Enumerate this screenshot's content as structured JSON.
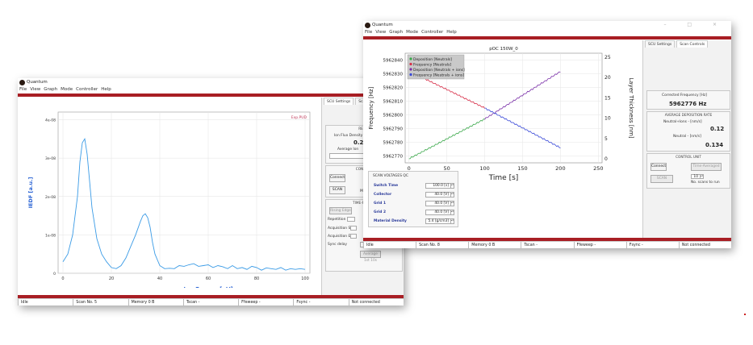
{
  "app": {
    "title": "Quantum"
  },
  "menu": [
    "File",
    "View",
    "Graph",
    "Mode",
    "Controller",
    "Help"
  ],
  "colors": {
    "accent": "#a81e24",
    "iedf_line": "#3a9be6",
    "dep_neutrals": "#3aa84a",
    "freq_neutrals": "#d8304a",
    "dep_neutrals_ions": "#7a2fa8",
    "freq_neutrals_ions": "#3a4ad8"
  },
  "back_window": {
    "tabs": [
      "SCU Settings",
      "Sca"
    ],
    "plot": {
      "corner_label": "Exp.PUD",
      "ylabel": "IEDF [a.u.]",
      "xlabel": "Ion Energy [eV]"
    },
    "panel": {
      "results_title": "RESUL",
      "ion_flux_label": "Ion Flux Density",
      "ion_flux_value": "0.2",
      "avg_label": "Average Ion",
      "control_title": "CONTROL",
      "connect": "Connect",
      "scan": "SCAN",
      "scan_side": "M",
      "time_title": "TIME-RESOLV",
      "rising_edge": "Rising Edge",
      "repetition": "Repetition",
      "acq_start": "Acquisition Start",
      "acq_end": "Acquisition End",
      "sync_delay": "Sync delay",
      "sync_value": "0 ns",
      "average_btn": "Average 1st 10s"
    },
    "status": [
      "Idle",
      "Scan No. 5",
      "Memory 0 B",
      "Tscan -",
      "Ffeweep -",
      "Fsync -",
      "Not connected"
    ]
  },
  "front_window": {
    "tabs": [
      "SCU Settings",
      "Scan Controls"
    ],
    "plot": {
      "title": "pOC 150W_0",
      "ylabel": "Frequency [Hz]",
      "y2label": "Layer Thickness [nm]",
      "xlabel": "Time [s]"
    },
    "scan_voltages": {
      "title": "SCAN VOLTAGES QC",
      "rows": [
        {
          "label": "Switch Time",
          "value": "100.0 [s]"
        },
        {
          "label": "Collector",
          "value": "40.0 [V]"
        },
        {
          "label": "Grid 1",
          "value": "40.0 [V]"
        },
        {
          "label": "Grid 2",
          "value": "40.0 [V]"
        },
        {
          "label": "Material Density",
          "value": "5.4 [g/cm3]"
        }
      ]
    },
    "panel": {
      "corrected_label": "Corrected Frequency [Hz]",
      "corrected_value": "5962776 Hz",
      "rate_title": "AVERAGE DEPOSITION RATE",
      "neutral_ions_label": "Neutral+Ions - [nm/s]",
      "neutral_ions_value": "0.12",
      "neutral_label": "Neutral - [nm/s]",
      "neutral_value": "0.134",
      "control_title": "CONTROL UNIT",
      "connect": "Connect",
      "time_averaged": "Time-Averaged",
      "scan": "SCAN",
      "scans_value": "10",
      "scans_label": "No. scans to run"
    },
    "status": [
      "Idle",
      "Scan No. 8",
      "Memory 0 B",
      "Tscan -",
      "Ffeweep -",
      "Fsync -",
      "Not connected"
    ]
  },
  "chart_data": [
    {
      "type": "line",
      "title": "",
      "xlabel": "Ion Energy [eV]",
      "ylabel": "IEDF [a.u.]",
      "xlim": [
        -2,
        102
      ],
      "ylim": [
        0,
        4.2e-08
      ],
      "x_ticks": [
        0,
        20,
        40,
        60,
        80,
        100
      ],
      "y_ticks": [
        0,
        1e-08,
        2e-08,
        3e-08,
        4e-08
      ],
      "y_tick_labels": [
        "0",
        "1e-08",
        "2e-08",
        "3e-08",
        "4e-08"
      ],
      "grid": true,
      "series": [
        {
          "x": [
            0,
            2,
            4,
            6,
            7,
            8,
            9,
            10,
            11,
            12,
            14,
            16,
            18,
            20,
            22,
            24,
            26,
            28,
            30,
            32,
            33,
            34,
            35,
            36,
            37,
            38,
            40,
            42,
            44,
            46,
            48,
            50,
            52,
            54,
            56,
            58,
            60,
            62,
            64,
            66,
            68,
            70,
            72,
            74,
            76,
            78,
            80,
            82,
            84,
            86,
            88,
            90,
            92,
            94,
            96,
            98,
            100
          ],
          "y": [
            3e-09,
            5e-09,
            1e-08,
            2e-08,
            2.9e-08,
            3.4e-08,
            3.5e-08,
            3.1e-08,
            2.4e-08,
            1.7e-08,
            9e-09,
            5e-09,
            3e-09,
            1.5e-09,
            1.2e-09,
            2e-09,
            4e-09,
            7e-09,
            1e-08,
            1.35e-08,
            1.5e-08,
            1.55e-08,
            1.45e-08,
            1.2e-08,
            8e-09,
            5e-09,
            2e-09,
            1.2e-09,
            1.3e-09,
            1.2e-09,
            2e-09,
            1.8e-09,
            2.2e-09,
            2.5e-09,
            1.8e-09,
            2e-09,
            2.2e-09,
            1.5e-09,
            2e-09,
            1.7e-09,
            1.2e-09,
            2e-09,
            1.2e-09,
            1.5e-09,
            1e-09,
            1.8e-09,
            1.5e-09,
            8e-10,
            1.4e-09,
            1.2e-09,
            1e-09,
            1.5e-09,
            8e-10,
            1.2e-09,
            1e-09,
            1.2e-09,
            1e-09
          ]
        }
      ]
    },
    {
      "type": "line",
      "title": "pOC 150W_0",
      "xlabel": "Time [s]",
      "ylabel": "Frequency [Hz]",
      "y2label": "Layer Thickness [nm]",
      "xlim": [
        -5,
        255
      ],
      "ylim": [
        5962765,
        5962845
      ],
      "y2lim": [
        -1,
        26
      ],
      "x_ticks": [
        0,
        50,
        100,
        150,
        200,
        250
      ],
      "y_ticks": [
        5962770,
        5962780,
        5962790,
        5962800,
        5962810,
        5962820,
        5962830,
        5962840
      ],
      "y2_ticks": [
        0,
        5,
        10,
        15,
        20,
        25
      ],
      "grid": true,
      "legend": "top-left",
      "series": [
        {
          "name": "Deposition [Neutrals]",
          "axis": "y2",
          "x": [
            0,
            100
          ],
          "y": [
            0,
            9.8
          ]
        },
        {
          "name": "Frequency [Neutrals]",
          "axis": "y",
          "x": [
            0,
            100
          ],
          "y": [
            5962832,
            5962805
          ]
        },
        {
          "name": "Deposition [Neutrals + ions]",
          "axis": "y2",
          "x": [
            100,
            200
          ],
          "y": [
            9.8,
            21.5
          ]
        },
        {
          "name": "Frequency [Neutrals + ions]",
          "axis": "y",
          "x": [
            100,
            200
          ],
          "y": [
            5962805,
            5962776
          ]
        }
      ]
    }
  ]
}
